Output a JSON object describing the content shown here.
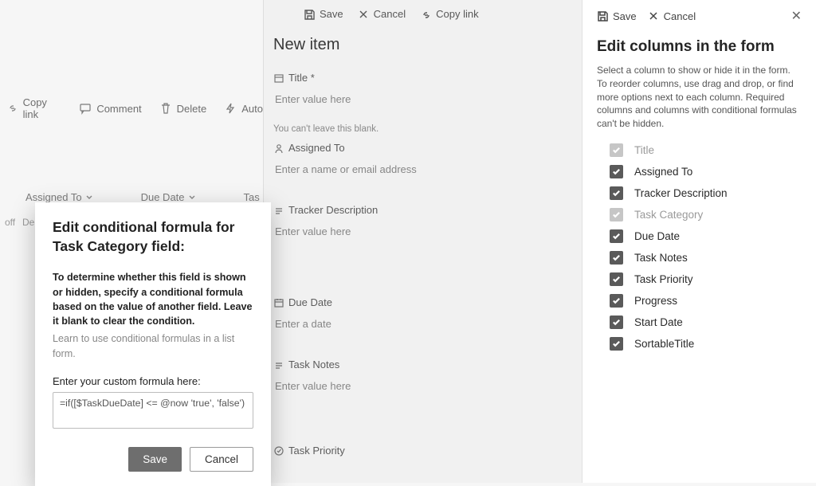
{
  "backToolbar": {
    "copyLink": "Copy link",
    "comment": "Comment",
    "delete": "Delete",
    "auto": "Auto"
  },
  "gridHead": {
    "col1": "Assigned To",
    "col2": "Due Date",
    "col3": "Tas"
  },
  "gridRow": {
    "c1": "off",
    "c2": "De"
  },
  "middle": {
    "save": "Save",
    "cancel": "Cancel",
    "copyLink": "Copy link",
    "title": "New item",
    "fields": {
      "title": {
        "label": "Title *",
        "placeholder": "Enter value here",
        "error": "You can't leave this blank."
      },
      "assignedTo": {
        "label": "Assigned To",
        "placeholder": "Enter a name or email address"
      },
      "trackerDesc": {
        "label": "Tracker Description",
        "placeholder": "Enter value here"
      },
      "dueDate": {
        "label": "Due Date",
        "placeholder": "Enter a date"
      },
      "taskNotes": {
        "label": "Task Notes",
        "placeholder": "Enter value here"
      },
      "taskPriority": {
        "label": "Task Priority"
      }
    }
  },
  "right": {
    "save": "Save",
    "cancel": "Cancel",
    "title": "Edit columns in the form",
    "desc": "Select a column to show or hide it in the form. To reorder columns, use drag and drop, or find more options next to each column. Required columns and columns with conditional formulas can't be hidden.",
    "columns": [
      {
        "label": "Title",
        "enabled": false
      },
      {
        "label": "Assigned To",
        "enabled": true
      },
      {
        "label": "Tracker Description",
        "enabled": true
      },
      {
        "label": "Task Category",
        "enabled": false
      },
      {
        "label": "Due Date",
        "enabled": true
      },
      {
        "label": "Task Notes",
        "enabled": true
      },
      {
        "label": "Task Priority",
        "enabled": true
      },
      {
        "label": "Progress",
        "enabled": true
      },
      {
        "label": "Start Date",
        "enabled": true
      },
      {
        "label": "SortableTitle",
        "enabled": true
      }
    ]
  },
  "dialog": {
    "title": "Edit conditional formula for Task Category field:",
    "bodyStrong": "To determine whether this field is shown or hidden, specify a conditional formula based on the value of another field. Leave it blank to clear the condition.",
    "link": "Learn to use conditional formulas in a list form.",
    "fieldLabel": "Enter your custom formula here:",
    "formula": "=if([$TaskDueDate] <= @now 'true', 'false')",
    "save": "Save",
    "cancel": "Cancel"
  }
}
